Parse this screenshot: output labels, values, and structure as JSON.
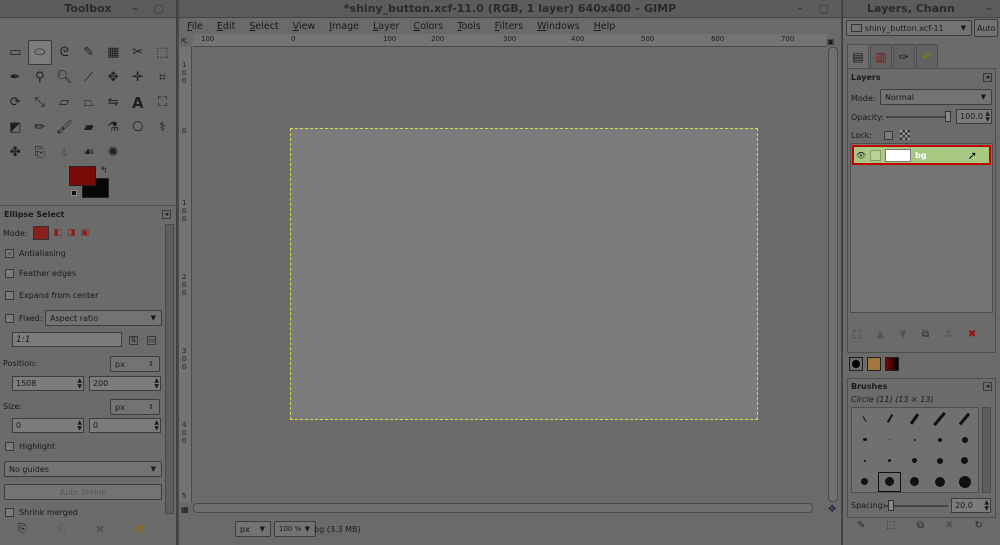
{
  "toolbox": {
    "title": "Toolbox",
    "tools": [
      "rect-select",
      "ellipse-select",
      "free-select",
      "fuzzy-select",
      "select-by-color",
      "scissors-select",
      "foreground-select",
      "paths",
      "color-picker",
      "zoom",
      "measure",
      "move",
      "align",
      "crop",
      "rotate",
      "scale",
      "shear",
      "perspective",
      "flip",
      "text",
      "cage",
      "bucket-fill",
      "pencil",
      "paintbrush",
      "eraser",
      "airbrush",
      "clone",
      "heal",
      "smudge",
      "dodge",
      "blur",
      "ink",
      "perspective-clone"
    ],
    "options": {
      "title": "Ellipse Select",
      "mode_label": "Mode:",
      "antialiasing": "Antialiasing",
      "feather_edges": "Feather edges",
      "expand_from_center": "Expand from center",
      "fixed_label": "Fixed:",
      "fixed_value": "Aspect ratio",
      "ratio_value": "1:1",
      "position_label": "Position:",
      "position_unit": "px",
      "position_x": "1508",
      "position_y": "200",
      "size_label": "Size:",
      "size_unit": "px",
      "size_w": "0",
      "size_h": "0",
      "highlight": "Highlight",
      "guides": "No guides",
      "auto_shrink": "Auto Shrink",
      "shrink_merged": "Shrink merged"
    },
    "colors": {
      "foreground": "#7a0a0a",
      "background": "#070707"
    }
  },
  "image_window": {
    "title": "*shiny_button.xcf-11.0 (RGB, 1 layer) 640x400 – GIMP",
    "menu": [
      "File",
      "Edit",
      "Select",
      "View",
      "Image",
      "Layer",
      "Colors",
      "Tools",
      "Filters",
      "Windows",
      "Help"
    ],
    "ruler_h": [
      "100",
      "0",
      "100",
      "200",
      "300",
      "400",
      "500",
      "600",
      "700"
    ],
    "ruler_v": [
      "1 0 0",
      "0",
      "1 0 0",
      "2 0 0",
      "3 0 0",
      "4 0 0",
      "5"
    ],
    "status": {
      "unit": "px",
      "zoom": "100 %",
      "info": "bg (3.3 MB)"
    }
  },
  "dock": {
    "title": "Layers, Chann",
    "image_select": "shiny_button.xcf-11",
    "auto_label": "Auto",
    "layers": {
      "title": "Layers",
      "mode_label": "Mode:",
      "mode_value": "Normal",
      "opacity_label": "Opacity:",
      "opacity_value": "100.0",
      "lock_label": "Lock:",
      "layer_name": "bg"
    },
    "brushes": {
      "title": "Brushes",
      "selected": "Circle (11) (13 × 13)",
      "spacing_label": "Spacing:",
      "spacing_value": "20.0"
    }
  }
}
